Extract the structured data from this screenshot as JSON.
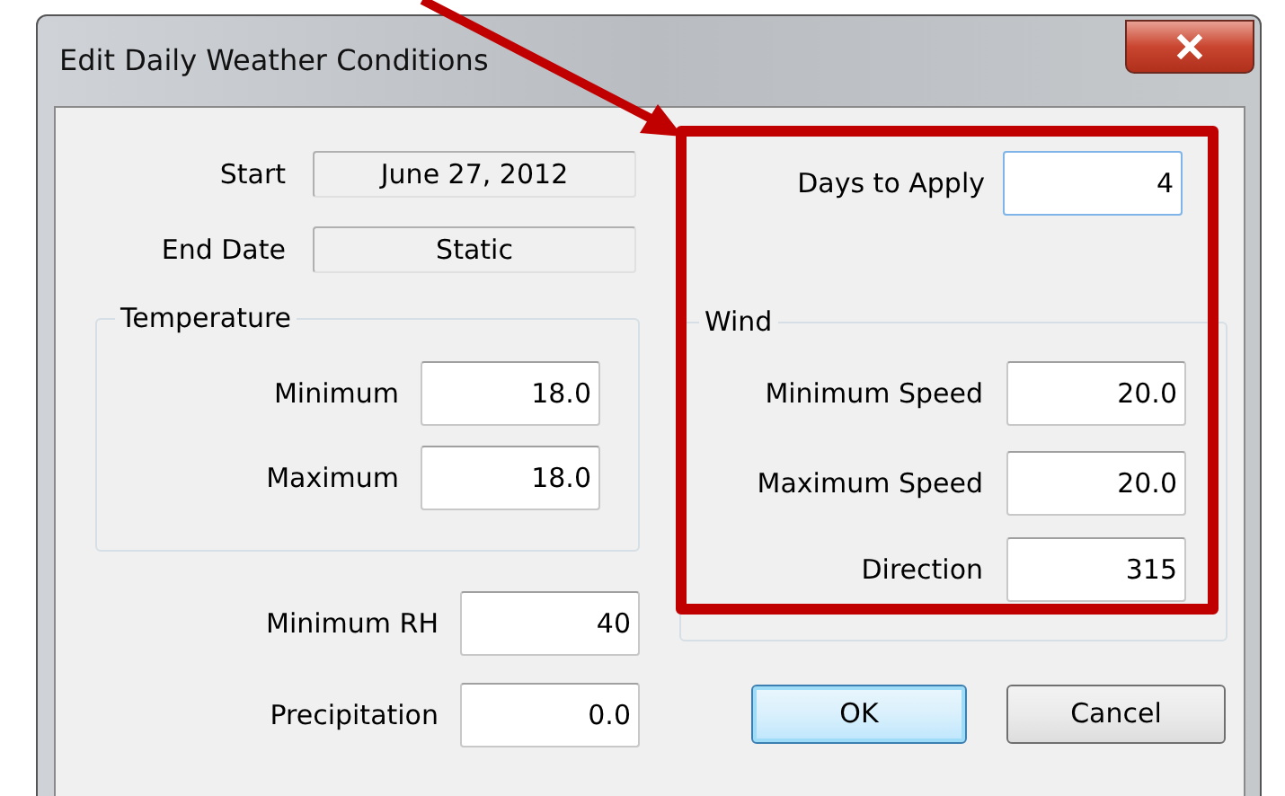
{
  "window": {
    "title": "Edit Daily Weather Conditions"
  },
  "dates": [
    {
      "label": "Start",
      "value": "June 27, 2012",
      "readonly": true
    },
    {
      "label": "End Date",
      "value": "Static",
      "readonly": true
    }
  ],
  "temperature": {
    "title": "Temperature",
    "fields": [
      {
        "label": "Minimum",
        "value": "18.0"
      },
      {
        "label": "Maximum",
        "value": "18.0"
      }
    ]
  },
  "conditions": [
    {
      "label": "Minimum RH",
      "value": "40"
    },
    {
      "label": "Precipitation",
      "value": "0.0"
    }
  ],
  "days_to_apply": {
    "label": "Days to Apply",
    "value": "4",
    "focused": true
  },
  "wind": {
    "title": "Wind",
    "fields": [
      {
        "label": "Minimum Speed",
        "value": "20.0"
      },
      {
        "label": "Maximum Speed",
        "value": "20.0"
      },
      {
        "label": "Direction",
        "value": "315"
      }
    ]
  },
  "buttons": [
    {
      "label": "OK",
      "default": true
    },
    {
      "label": "Cancel",
      "default": false
    }
  ]
}
